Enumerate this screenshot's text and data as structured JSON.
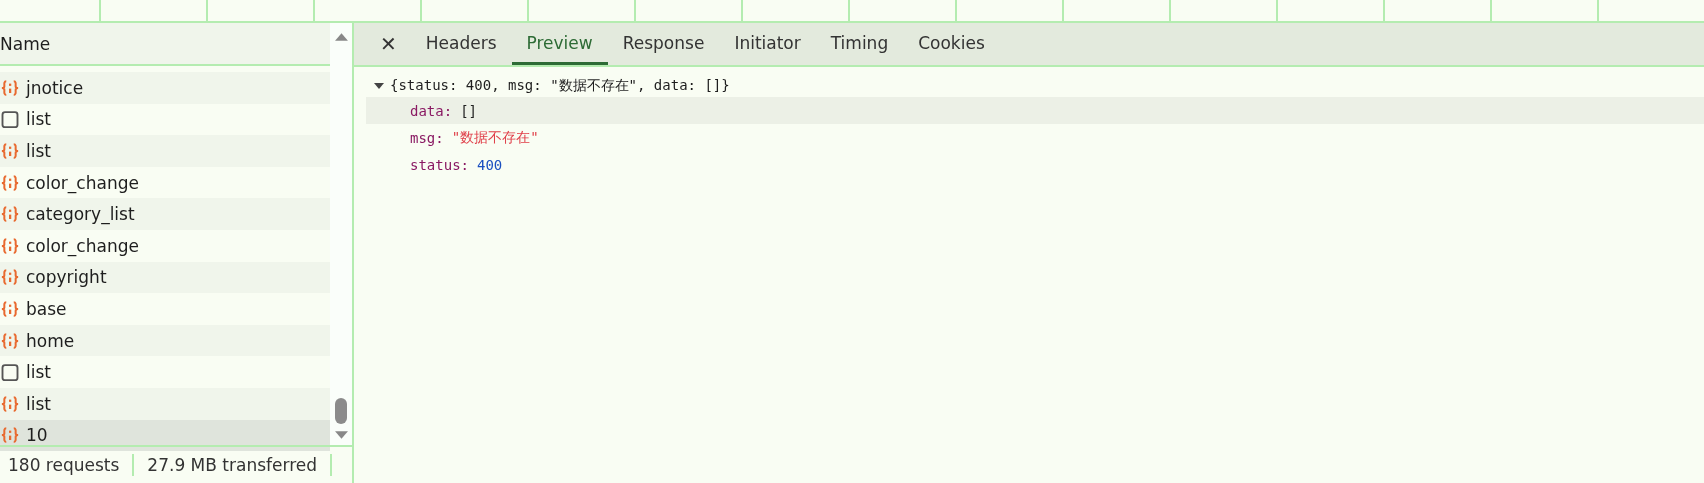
{
  "requests": {
    "column": "Name",
    "rows": [
      {
        "name": "jnotice",
        "kind": "json",
        "selected": false
      },
      {
        "name": "list",
        "kind": "doc",
        "selected": false
      },
      {
        "name": "list",
        "kind": "json",
        "selected": false
      },
      {
        "name": "color_change",
        "kind": "json",
        "selected": false
      },
      {
        "name": "category_list",
        "kind": "json",
        "selected": false
      },
      {
        "name": "color_change",
        "kind": "json",
        "selected": false
      },
      {
        "name": "copyright",
        "kind": "json",
        "selected": false
      },
      {
        "name": "base",
        "kind": "json",
        "selected": false
      },
      {
        "name": "home",
        "kind": "json",
        "selected": false
      },
      {
        "name": "list",
        "kind": "doc",
        "selected": false
      },
      {
        "name": "list",
        "kind": "json",
        "selected": false
      },
      {
        "name": "10",
        "kind": "json",
        "selected": true
      }
    ]
  },
  "status_bar": [
    "180 requests",
    "27.9 MB transferred"
  ],
  "tabs": [
    {
      "label": "Headers",
      "selected": false
    },
    {
      "label": "Preview",
      "selected": true
    },
    {
      "label": "Response",
      "selected": false
    },
    {
      "label": "Initiator",
      "selected": false
    },
    {
      "label": "Timing",
      "selected": false
    },
    {
      "label": "Cookies",
      "selected": false
    }
  ],
  "close_button": "✕",
  "preview": {
    "expanded": true,
    "summary": "{status: 400, msg: \"数据不存在\", data: []}",
    "properties": [
      {
        "key": "data:",
        "value": "[]",
        "kind": "array"
      },
      {
        "key": "msg:",
        "value": "\"数据不存在\"",
        "kind": "string"
      },
      {
        "key": "status:",
        "value": "400",
        "kind": "number"
      }
    ]
  }
}
